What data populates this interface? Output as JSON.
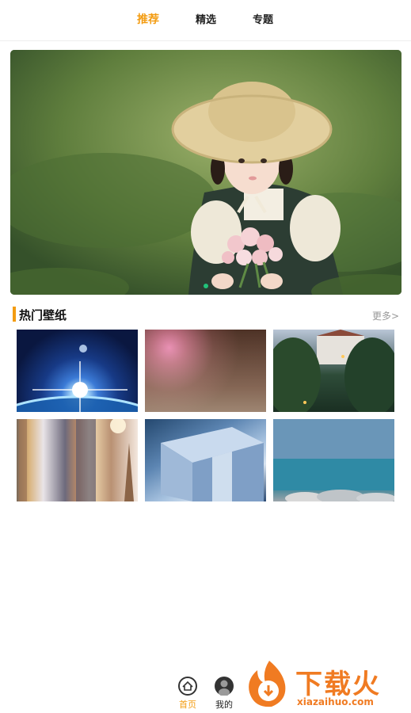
{
  "tabs": [
    {
      "label": "推荐",
      "active": true
    },
    {
      "label": "精选",
      "active": false
    },
    {
      "label": "专题",
      "active": false
    }
  ],
  "banner": {
    "subject": "girl-in-straw-hat-with-flowers",
    "slide_count": 1,
    "active_slide": 1
  },
  "section": {
    "title": "热门壁纸",
    "more_label": "更多>"
  },
  "wallpapers": [
    {
      "subject": "earth-sunrise-space"
    },
    {
      "subject": "blurred-dark-bokeh"
    },
    {
      "subject": "castle-by-forest-at-dusk"
    },
    {
      "subject": "skyscrapers-sunset"
    },
    {
      "subject": "blue-gift-box"
    },
    {
      "subject": "sea-rocky-shore"
    }
  ],
  "bottom_nav": {
    "home_label": "首页",
    "me_label": "我的"
  },
  "watermark": {
    "brand": "下载火",
    "url": "xiazaihuo.com"
  },
  "colors": {
    "accent": "#f39c12",
    "watermark": "#f07b22"
  }
}
